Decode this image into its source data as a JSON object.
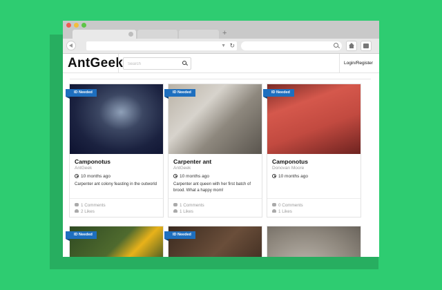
{
  "browser": {
    "window_dots": [
      {
        "name": "close",
        "color": "#ee5c52"
      },
      {
        "name": "minimize",
        "color": "#f2be3c"
      },
      {
        "name": "maximize",
        "color": "#5ec447"
      }
    ],
    "new_tab_symbol": "+",
    "url_value": "",
    "search_value": ""
  },
  "site": {
    "logo": "AntGeek",
    "search_placeholder": "Search",
    "login_label": "Login/Register",
    "accent_color": "#1e6fbf",
    "background_color": "#2ecc71"
  },
  "cards": [
    {
      "badge": "ID Needed",
      "title": "Camponotus",
      "author": "AntGeek",
      "time": "10 months ago",
      "description": "Carpenter ant colony feasting in the outworld",
      "comments": "1 Comments",
      "likes": "2 Likes"
    },
    {
      "badge": "ID Needed",
      "title": "Carpenter ant",
      "author": "AntGeek",
      "time": "10 months ago",
      "description": "Carpenter ant queen with her first batch of brood. What a happy mom!",
      "comments": "1 Comments",
      "likes": "1 Likes"
    },
    {
      "badge": "ID Needed",
      "title": "Camponotus",
      "author": "Donovan Moore",
      "time": "10 months ago",
      "description": "",
      "comments": "0 Comments",
      "likes": "1 Likes"
    },
    {
      "badge": "ID Needed"
    },
    {
      "badge": "ID Needed"
    },
    {}
  ]
}
